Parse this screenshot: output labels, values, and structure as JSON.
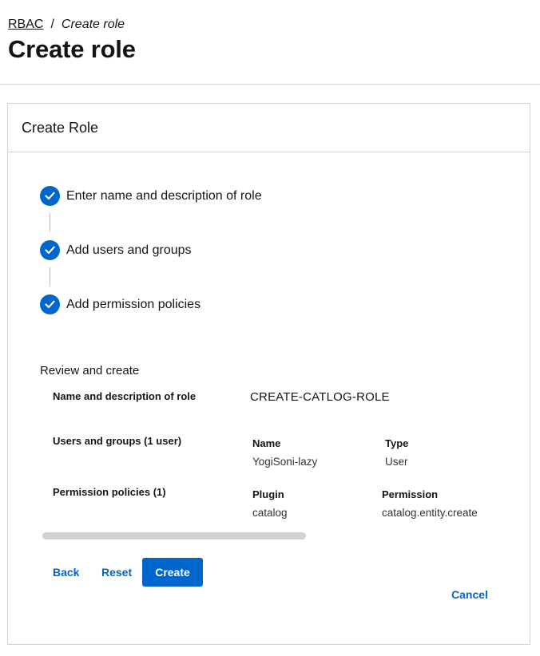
{
  "breadcrumb": {
    "root": "RBAC",
    "separator": "/",
    "current": "Create role"
  },
  "page": {
    "title": "Create role"
  },
  "card": {
    "title": "Create Role"
  },
  "steps": [
    {
      "label": "Enter name and description of role",
      "status": "completed",
      "icon": "check-circle-icon"
    },
    {
      "label": "Add users and groups",
      "status": "completed",
      "icon": "check-circle-icon"
    },
    {
      "label": "Add permission policies",
      "status": "completed",
      "icon": "check-circle-icon"
    }
  ],
  "review": {
    "title": "Review and create",
    "name_label": "Name and description of role",
    "name_value": "CREATE-CATLOG-ROLE",
    "users_label": "Users and groups (1 user)",
    "users_columns": [
      "Name",
      "Type"
    ],
    "users_rows": [
      [
        "YogiSoni-lazy",
        "User"
      ]
    ],
    "policies_label": "Permission policies (1)",
    "policies_columns": [
      "Plugin",
      "Permission"
    ],
    "policies_rows": [
      [
        "catalog",
        "catalog.entity.create"
      ]
    ]
  },
  "actions": {
    "back": "Back",
    "reset": "Reset",
    "create": "Create",
    "cancel": "Cancel"
  },
  "colors": {
    "accent": "#0066cc",
    "border": "#d2d2d2",
    "text": "#151515"
  }
}
